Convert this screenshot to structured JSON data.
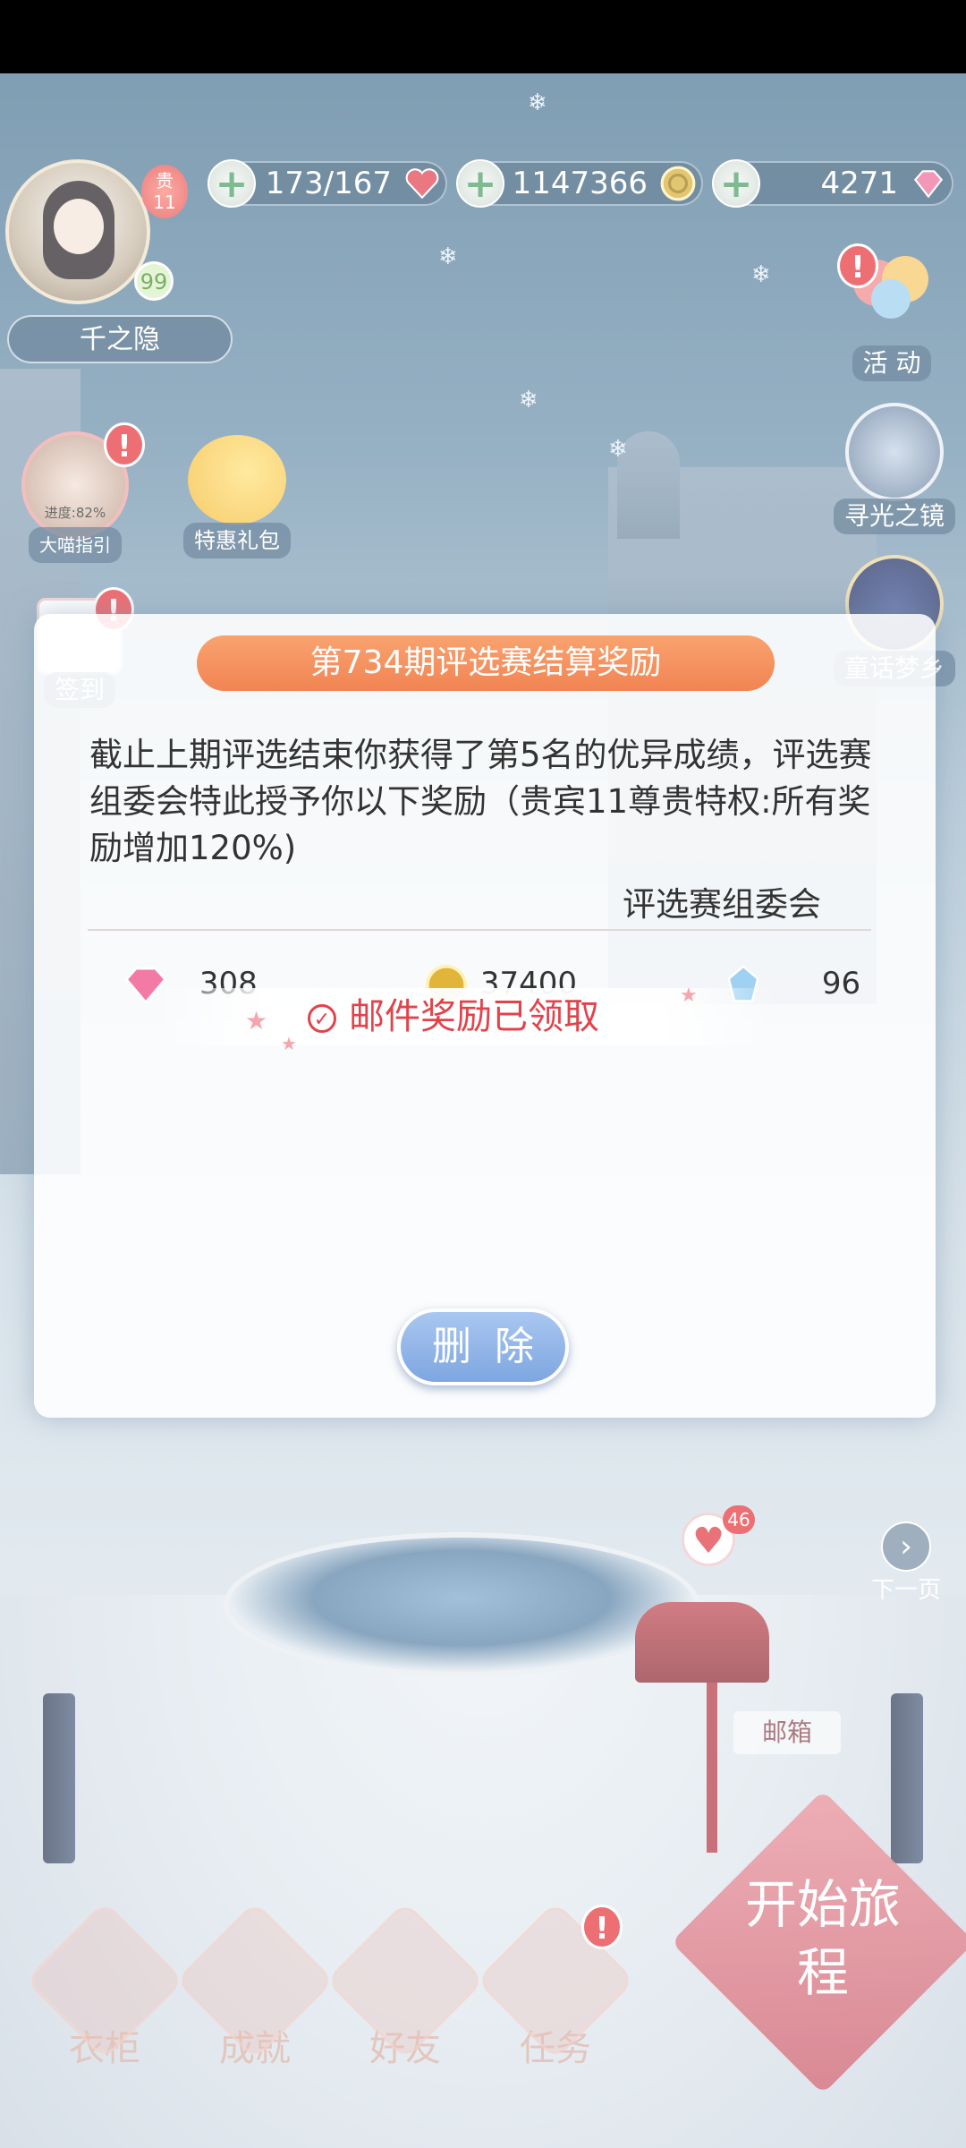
{
  "top_bar": {
    "player_name": "千之隐",
    "vip_label": "贵",
    "vip_level": "11",
    "level": "99",
    "resources": [
      {
        "name": "stamina",
        "value": "173/167",
        "icon": "heart-icon",
        "color": "#e24452"
      },
      {
        "name": "gold",
        "value": "1147366",
        "icon": "gold-coin-icon",
        "color": "#d8b03a"
      },
      {
        "name": "diamond",
        "value": "4271",
        "icon": "pink-diamond-icon",
        "color": "#ef6f9c"
      }
    ]
  },
  "left_buttons": {
    "guide_progress": "进度:82%",
    "guide_label": "大喵指引",
    "gift_label": "特惠礼包",
    "signin_label": "签到"
  },
  "right_buttons": {
    "activity_label": "活 动",
    "mirror_label": "寻光之镜",
    "dream_label": "童话梦乡"
  },
  "dialog": {
    "title": "第734期评选赛结算奖励",
    "body": "截止上期评选结束你获得了第5名的优异成绩，评选赛组委会特此授予你以下奖励（贵宾11尊贵特权:所有奖励增加120%)",
    "signature": "评选赛组委会",
    "rewards": [
      {
        "icon": "pink-diamond-icon",
        "amount": "308"
      },
      {
        "icon": "gold-coin-icon",
        "amount": "37400"
      },
      {
        "icon": "blue-crystal-icon",
        "amount": "96"
      }
    ],
    "claimed_text": "邮件奖励已领取",
    "delete_label": "删除"
  },
  "scene": {
    "mailbox_count": "46",
    "mailbox_label": "邮箱",
    "next_page_label": "下一页"
  },
  "bottom_nav": [
    {
      "label": "衣柜",
      "icon": "wardrobe-icon"
    },
    {
      "label": "成就",
      "icon": "achievement-icon"
    },
    {
      "label": "好友",
      "icon": "friends-icon"
    },
    {
      "label": "任务",
      "icon": "tasks-icon"
    }
  ],
  "start_journey": "开始旅程",
  "colors": {
    "accent_orange": "#f18453",
    "claimed_red": "#e2434a",
    "button_blue": "#7ea6e0"
  }
}
